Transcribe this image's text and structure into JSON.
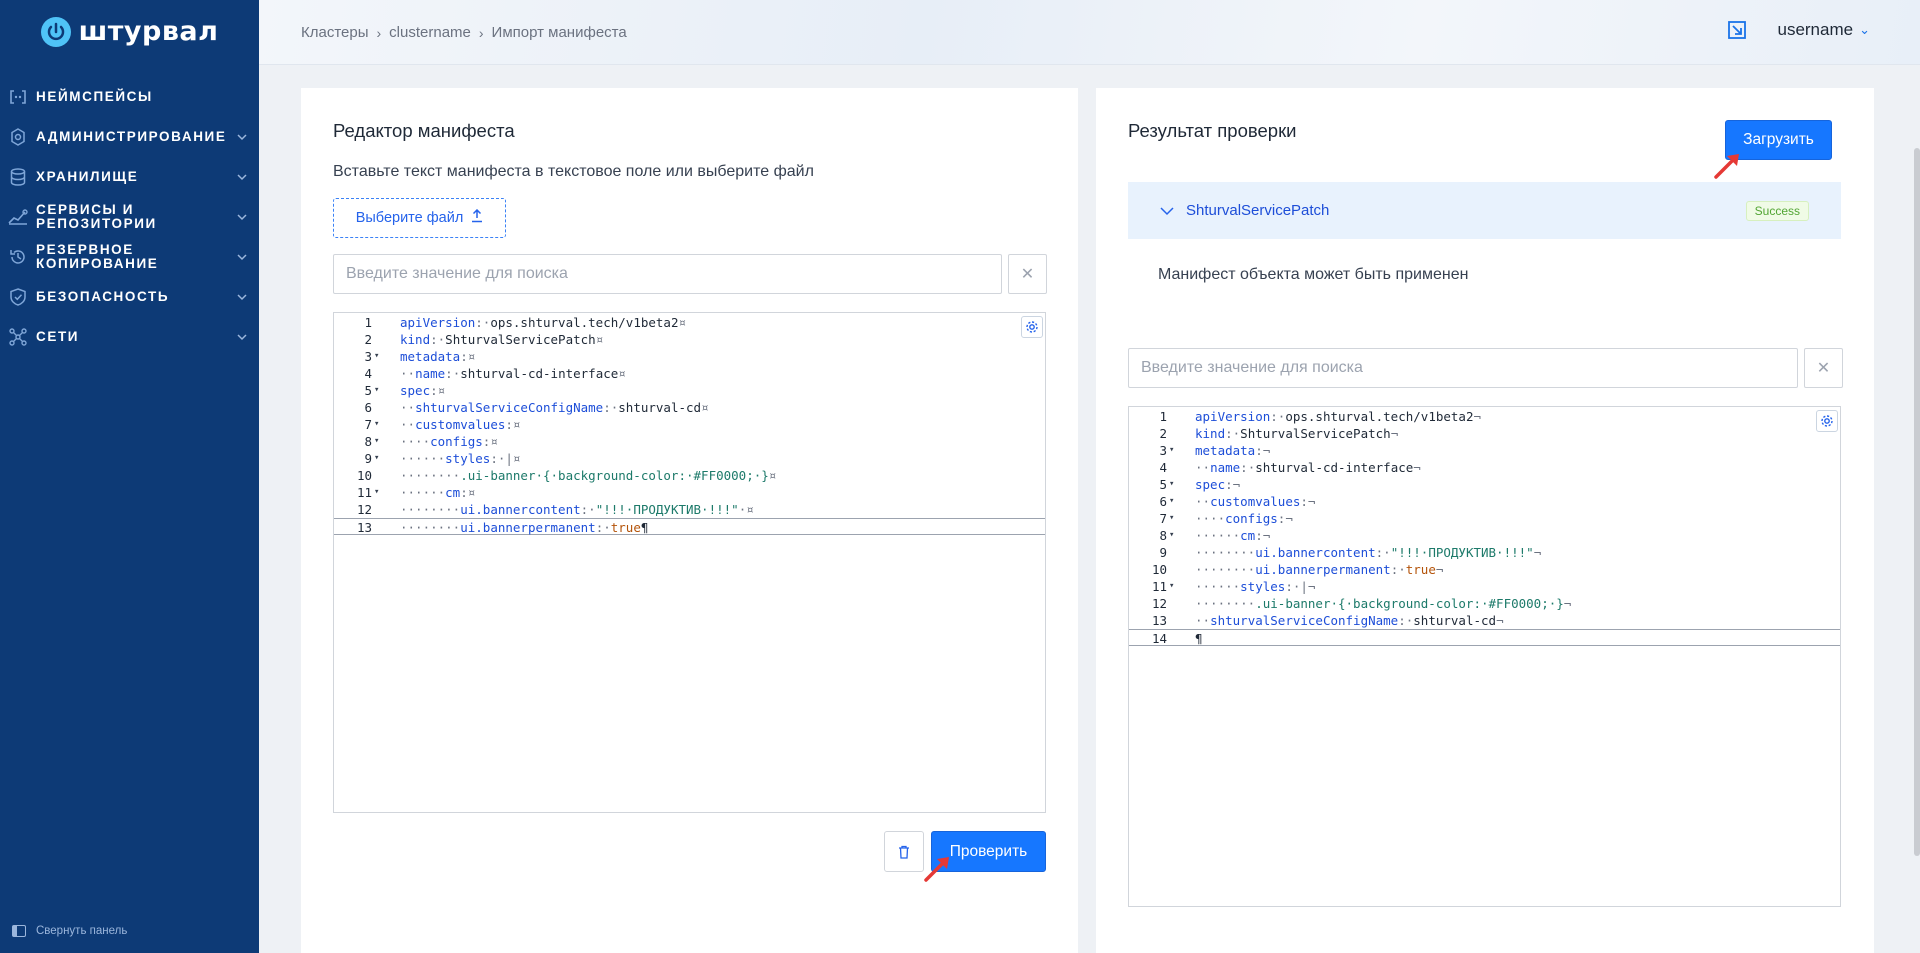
{
  "app": {
    "logo_text": "штурвал"
  },
  "sidebar": {
    "items": [
      {
        "label": "Неймспейсы",
        "has_children": false
      },
      {
        "label": "Администрирование",
        "has_children": true
      },
      {
        "label": "Хранилище",
        "has_children": true
      },
      {
        "label": "Сервисы и репозитории",
        "has_children": true
      },
      {
        "label": "Резервное копирование",
        "has_children": true
      },
      {
        "label": "Безопасность",
        "has_children": true
      },
      {
        "label": "Сети",
        "has_children": true
      }
    ],
    "collapse_label": "Свернуть панель"
  },
  "header": {
    "breadcrumb": [
      "Кластеры",
      "clustername",
      "Импорт манифеста"
    ],
    "username": "username"
  },
  "editor_panel": {
    "title": "Редактор манифеста",
    "description": "Вставьте текст манифеста в текстовое поле или выберите файл",
    "file_button": "Выберите файл",
    "search_placeholder": "Введите значение для поиска",
    "check_button": "Проверить",
    "lines": [
      {
        "n": "1",
        "fold": false,
        "html": "<span class='k'>apiVersion</span><span class='p'>:·</span>ops.shturval.tech/v1beta2<span class='p'>¤</span>"
      },
      {
        "n": "2",
        "fold": false,
        "html": "<span class='k'>kind</span><span class='p'>:·</span>ShturvalServicePatch<span class='p'>¤</span>"
      },
      {
        "n": "3",
        "fold": true,
        "html": "<span class='k'>metadata</span><span class='p'>:¤</span>"
      },
      {
        "n": "4",
        "fold": false,
        "html": "<span class='p'>··</span><span class='k'>name</span><span class='p'>:·</span>shturval-cd-interface<span class='p'>¤</span>"
      },
      {
        "n": "5",
        "fold": true,
        "html": "<span class='k'>spec</span><span class='p'>:¤</span>"
      },
      {
        "n": "6",
        "fold": false,
        "html": "<span class='p'>··</span><span class='k'>shturvalServiceConfigName</span><span class='p'>:·</span>shturval-cd<span class='p'>¤</span>"
      },
      {
        "n": "7",
        "fold": true,
        "html": "<span class='p'>··</span><span class='k'>customvalues</span><span class='p'>:¤</span>"
      },
      {
        "n": "8",
        "fold": true,
        "html": "<span class='p'>····</span><span class='k'>configs</span><span class='p'>:¤</span>"
      },
      {
        "n": "9",
        "fold": true,
        "html": "<span class='p'>······</span><span class='k'>styles</span><span class='p'>:·|¤</span>"
      },
      {
        "n": "10",
        "fold": false,
        "html": "<span class='p'>········</span><span class='s'>.ui-banner·{·background-color:·#FF0000;·}</span><span class='p'>¤</span>"
      },
      {
        "n": "11",
        "fold": true,
        "html": "<span class='p'>······</span><span class='k'>cm</span><span class='p'>:¤</span>"
      },
      {
        "n": "12",
        "fold": false,
        "html": "<span class='p'>········</span><span class='k'>ui.bannercontent</span><span class='p'>:·</span><span class='s'>\"!!!·ПРОДУКТИВ·!!!\"</span><span class='p'>·¤</span>"
      },
      {
        "n": "13",
        "fold": false,
        "active": true,
        "html": "<span class='p'>········</span><span class='k'>ui.bannerpermanent</span><span class='p'>:·</span><span class='b'>true</span>¶"
      }
    ]
  },
  "result_panel": {
    "title": "Результат проверки",
    "upload_button": "Загрузить",
    "result_name": "ShturvalServicePatch",
    "result_status": "Success",
    "result_message": "Манифест объекта может быть применен",
    "search_placeholder": "Введите значение для поиска",
    "lines": [
      {
        "n": "1",
        "fold": false,
        "html": "<span class='k'>apiVersion</span><span class='p'>:·</span>ops.shturval.tech/v1beta2<span class='p'>¬</span>"
      },
      {
        "n": "2",
        "fold": false,
        "html": "<span class='k'>kind</span><span class='p'>:·</span>ShturvalServicePatch<span class='p'>¬</span>"
      },
      {
        "n": "3",
        "fold": true,
        "html": "<span class='k'>metadata</span><span class='p'>:¬</span>"
      },
      {
        "n": "4",
        "fold": false,
        "html": "<span class='p'>··</span><span class='k'>name</span><span class='p'>:·</span>shturval-cd-interface<span class='p'>¬</span>"
      },
      {
        "n": "5",
        "fold": true,
        "html": "<span class='k'>spec</span><span class='p'>:¬</span>"
      },
      {
        "n": "6",
        "fold": true,
        "html": "<span class='p'>··</span><span class='k'>customvalues</span><span class='p'>:¬</span>"
      },
      {
        "n": "7",
        "fold": true,
        "html": "<span class='p'>····</span><span class='k'>configs</span><span class='p'>:¬</span>"
      },
      {
        "n": "8",
        "fold": true,
        "html": "<span class='p'>······</span><span class='k'>cm</span><span class='p'>:¬</span>"
      },
      {
        "n": "9",
        "fold": false,
        "html": "<span class='p'>········</span><span class='k'>ui.bannercontent</span><span class='p'>:·</span><span class='s'>\"!!!·ПРОДУКТИВ·!!!\"</span><span class='p'>¬</span>"
      },
      {
        "n": "10",
        "fold": false,
        "html": "<span class='p'>········</span><span class='k'>ui.bannerpermanent</span><span class='p'>:·</span><span class='b'>true</span><span class='p'>¬</span>"
      },
      {
        "n": "11",
        "fold": true,
        "html": "<span class='p'>······</span><span class='k'>styles</span><span class='p'>:·|¬</span>"
      },
      {
        "n": "12",
        "fold": false,
        "html": "<span class='p'>········</span><span class='s'>.ui-banner·{·background-color:·#FF0000;·}</span><span class='p'>¬</span>"
      },
      {
        "n": "13",
        "fold": false,
        "html": "<span class='p'>··</span><span class='k'>shturvalServiceConfigName</span><span class='p'>:·</span>shturval-cd<span class='p'>¬</span>"
      },
      {
        "n": "14",
        "fold": false,
        "active": true,
        "html": "¶"
      }
    ]
  },
  "colors": {
    "sidebar_bg": "#0d3a76",
    "primary": "#1677ff",
    "success": "#52a534"
  }
}
